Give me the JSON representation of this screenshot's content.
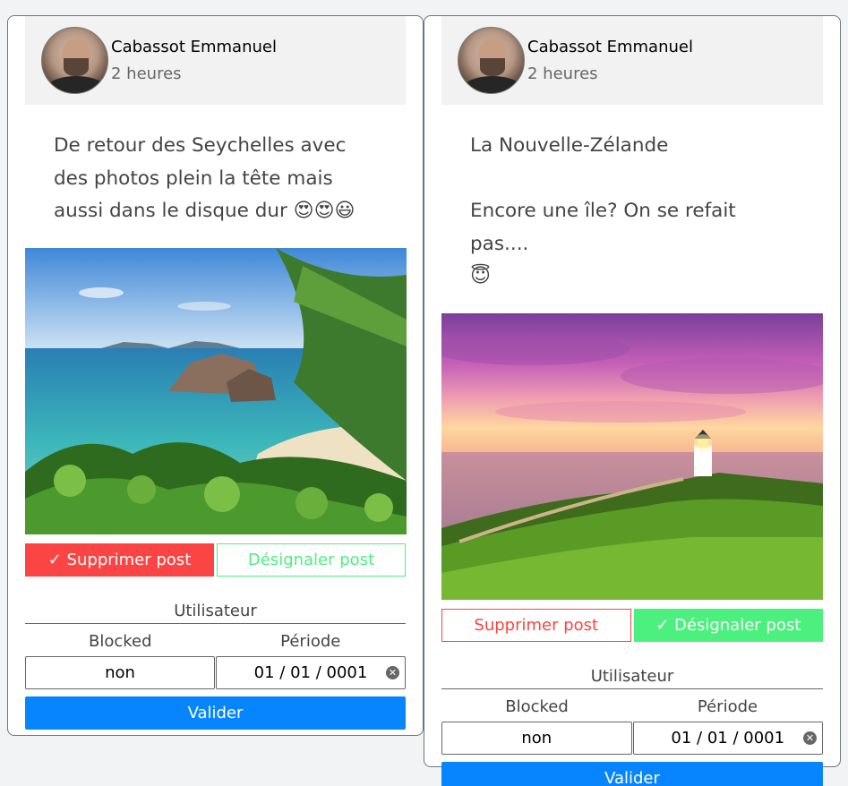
{
  "posts": [
    {
      "author": "Cabassot Emmanuel",
      "time": "2 heures",
      "text": "De retour des Seychelles avec des photos plein la tête mais aussi dans le disque dur",
      "emojis": "😍😍😃",
      "image_icon": "beach-photo",
      "delete_label": "✓ Supprimer post",
      "unflag_label": "Désignaler post",
      "admin": {
        "title": "Utilisateur",
        "blocked_label": "Blocked",
        "period_label": "Période",
        "blocked_value": "non",
        "period_value": "01 / 01 / 0001",
        "submit_label": "Valider"
      }
    },
    {
      "author": "Cabassot Emmanuel",
      "time": "2 heures",
      "text_line1": "La Nouvelle-Zélande",
      "text_line2": "Encore une île? On se refait pas....",
      "emojis": "😇",
      "image_icon": "lighthouse-photo",
      "delete_label": "Supprimer post",
      "unflag_label": "✓ Désignaler post",
      "admin": {
        "title": "Utilisateur",
        "blocked_label": "Blocked",
        "period_label": "Période",
        "blocked_value": "non",
        "period_value": "01 / 01 / 0001",
        "submit_label": "Valider"
      }
    }
  ],
  "colors": {
    "danger": "#fb4444",
    "success": "#4cf07e",
    "primary": "#0785ff",
    "header_bg": "#f2f2f2"
  }
}
